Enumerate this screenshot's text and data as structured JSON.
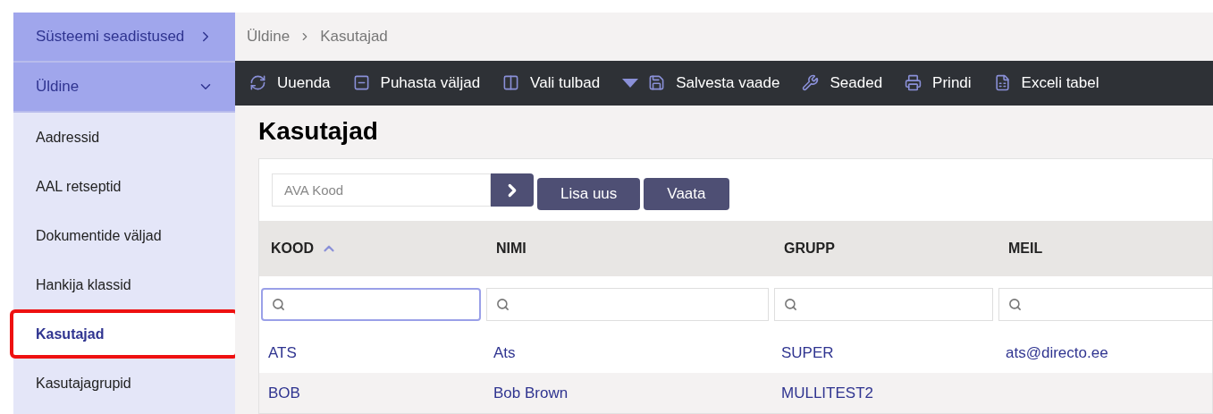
{
  "sidebar": {
    "sections": [
      {
        "label": "Süsteemi seadistused",
        "expanded": false
      },
      {
        "label": "Üldine",
        "expanded": true
      }
    ],
    "items": [
      {
        "label": "Aadressid",
        "selected": false
      },
      {
        "label": "AAL retseptid",
        "selected": false
      },
      {
        "label": "Dokumentide väljad",
        "selected": false
      },
      {
        "label": "Hankija klassid",
        "selected": false
      },
      {
        "label": "Kasutajad",
        "selected": true
      },
      {
        "label": "Kasutajagrupid",
        "selected": false
      }
    ]
  },
  "breadcrumb": [
    "Üldine",
    "Kasutajad"
  ],
  "toolbar": [
    {
      "kind": "refresh",
      "label": "Uuenda"
    },
    {
      "kind": "clear",
      "label": "Puhasta väljad"
    },
    {
      "kind": "columns",
      "label": "Vali tulbad"
    },
    {
      "kind": "dropdown"
    },
    {
      "kind": "save",
      "label": "Salvesta vaade"
    },
    {
      "kind": "settings",
      "label": "Seaded"
    },
    {
      "kind": "print",
      "label": "Prindi"
    },
    {
      "kind": "excel",
      "label": "Exceli tabel"
    }
  ],
  "title": "Kasutajad",
  "open_field": {
    "placeholder": "AVA Kood"
  },
  "buttons": [
    "Lisa uus",
    "Vaata"
  ],
  "table": {
    "columns": [
      {
        "label": "KOOD",
        "sorted": true,
        "filter_focused": true
      },
      {
        "label": "NIMI",
        "sorted": false,
        "filter_focused": false
      },
      {
        "label": "GRUPP",
        "sorted": false,
        "filter_focused": false
      },
      {
        "label": "MEIL",
        "sorted": false,
        "filter_focused": false
      }
    ],
    "rows": [
      [
        "ATS",
        "Ats",
        "SUPER",
        "ats@directo.ee"
      ],
      [
        "BOB",
        "Bob Brown",
        "MULLITEST2"
      ]
    ]
  }
}
